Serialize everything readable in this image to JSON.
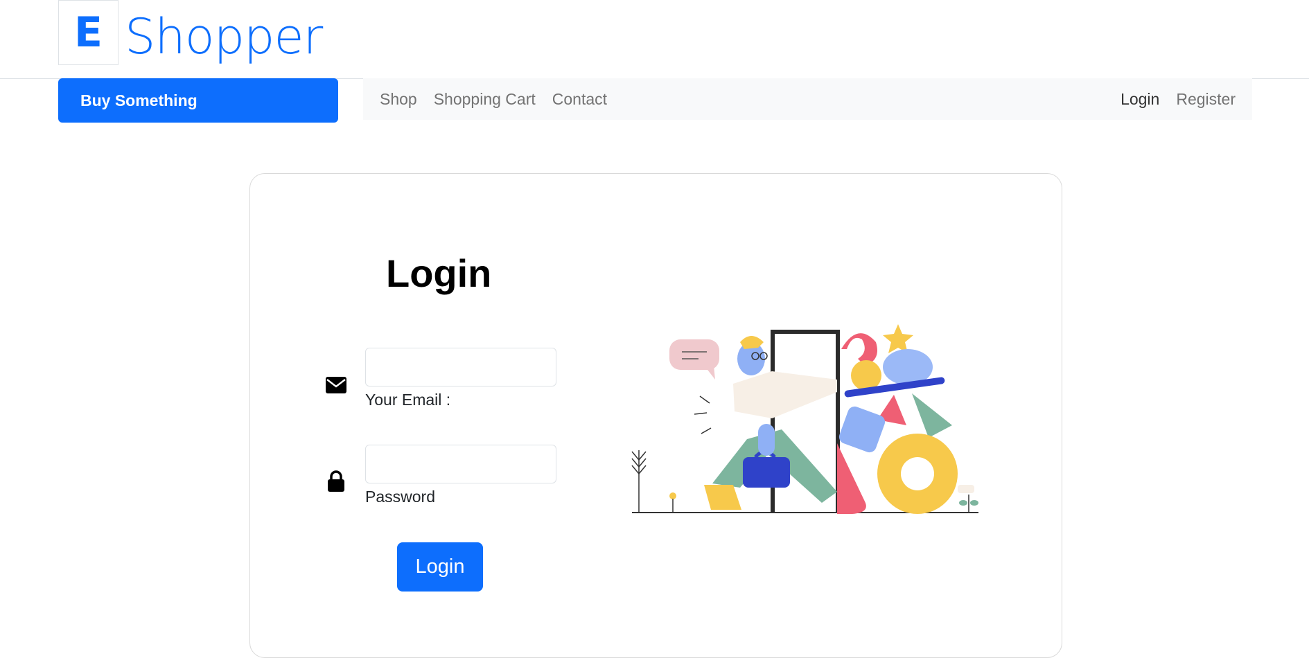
{
  "brand": {
    "letter": "E",
    "name": "Shopper"
  },
  "header": {
    "cta_label": "Buy Something"
  },
  "nav": {
    "left": [
      {
        "label": "Shop"
      },
      {
        "label": "Shopping Cart"
      },
      {
        "label": "Contact"
      }
    ],
    "right": [
      {
        "label": "Login"
      },
      {
        "label": "Register"
      }
    ]
  },
  "login_form": {
    "title": "Login",
    "email": {
      "label": "Your Email :",
      "value": "",
      "icon": "envelope-icon"
    },
    "password": {
      "label": "Password",
      "value": "",
      "icon": "lock-icon"
    },
    "submit_label": "Login"
  },
  "colors": {
    "accent": "#0d6efd",
    "nav_bg": "#f8f9fa"
  },
  "illustration": {
    "subject": "person-walking-through-door-with-shapes"
  }
}
